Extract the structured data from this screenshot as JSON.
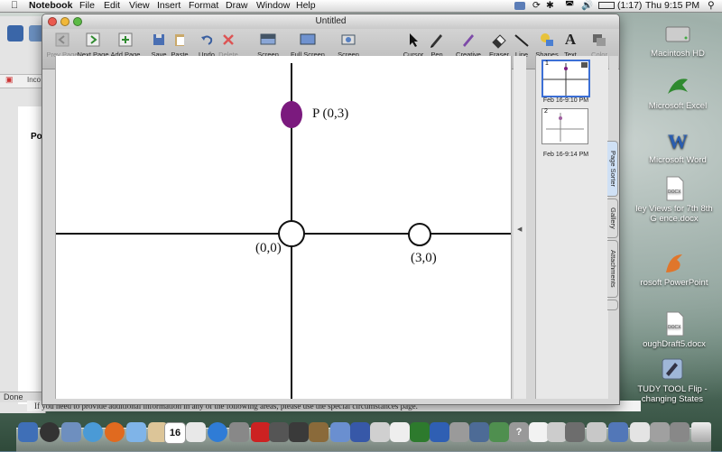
{
  "menubar": {
    "app_name": "Notebook",
    "items": [
      "File",
      "Edit",
      "View",
      "Insert",
      "Format",
      "Draw",
      "Window",
      "Help"
    ],
    "battery": "(1:17)",
    "clock": "Thu 9:15 PM"
  },
  "window": {
    "title": "Untitled"
  },
  "toolbar": {
    "prev_page": "Prev Page",
    "next_page": "Next Page",
    "add_page": "Add Page",
    "save": "Save",
    "paste": "Paste",
    "undo": "Undo",
    "delete": "Delete",
    "screen_shade": "Screen Shade",
    "full_screen": "Full Screen",
    "screen_capture": "Screen Capture",
    "cursor": "Cursor",
    "pen": "Pen",
    "creative_pen": "Creative Pen",
    "eraser": "Eraser",
    "line": "Line",
    "shapes": "Shapes",
    "text": "Text",
    "color": "Color"
  },
  "canvas": {
    "point_p_label": "P (0,3)",
    "origin_label": "(0,0)",
    "point_3_label": "(3,0)",
    "point_p_color": "#7b1a7e"
  },
  "page_sorter": {
    "thumbs": [
      {
        "number": "1",
        "date": "Feb 16-9:10 PM"
      },
      {
        "number": "2",
        "date": "Feb 16-9:14 PM"
      }
    ],
    "tabs": [
      "Page Sorter",
      "Gallery",
      "Attachments"
    ]
  },
  "background_window": {
    "status": "Done",
    "heading_fragment": "Po",
    "tab_fragment": "Inco",
    "bottom_text": "If you need to provide additional information in any of the following areas, please use the special circumstances page."
  },
  "desktop_icons": [
    {
      "label": "Macintosh HD",
      "icon": "hard-drive-icon"
    },
    {
      "label": "Microsoft Excel",
      "icon": "excel-icon"
    },
    {
      "label": "Microsoft Word",
      "icon": "word-icon"
    },
    {
      "label": "ley Views for 7th 8th G  ence.docx",
      "icon": "docx-file-icon"
    },
    {
      "label": "rosoft PowerPoint",
      "icon": "powerpoint-icon"
    },
    {
      "label": "oughDraft5.docx",
      "icon": "docx-file-icon"
    },
    {
      "label": "TUDY TOOL Flip - changing States",
      "icon": "app-icon"
    }
  ],
  "dock": {
    "calendar_day": "16"
  }
}
